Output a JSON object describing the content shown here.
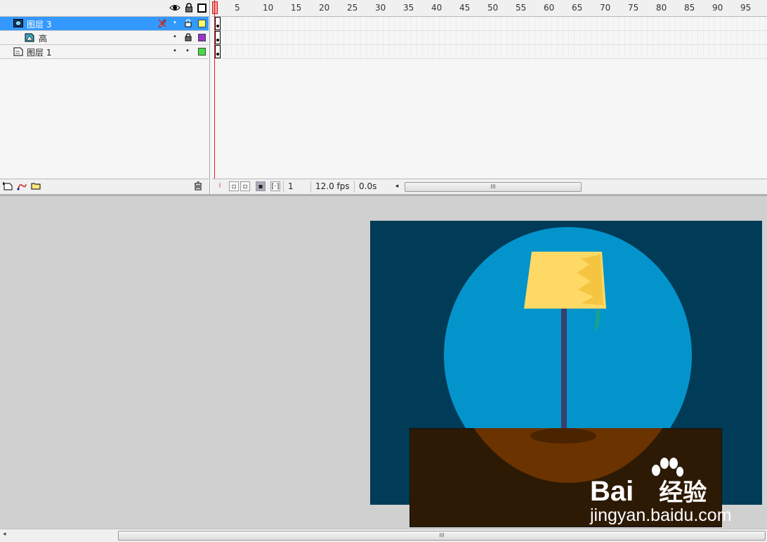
{
  "timeline": {
    "header_icons": [
      "eye-icon",
      "lock-icon",
      "outline-icon"
    ],
    "layers": [
      {
        "name": "图层 3",
        "type": "mask",
        "selected": true,
        "outline_color": "#ffff66"
      },
      {
        "name": "高",
        "type": "masked",
        "selected": false,
        "outline_color": "#9933cc"
      },
      {
        "name": "图层 1",
        "type": "normal",
        "selected": false,
        "outline_color": "#44dd44"
      }
    ],
    "ruler_ticks": [
      "1",
      "5",
      "10",
      "15",
      "20",
      "25",
      "30",
      "35",
      "40",
      "45",
      "50",
      "55",
      "60",
      "65",
      "70",
      "75",
      "80",
      "85",
      "90",
      "95"
    ],
    "current_frame": "1",
    "frame_rate": "12.0 fps",
    "elapsed_time": "0.0s",
    "scroll_grip": "III"
  },
  "watermark": {
    "brand": "Bai",
    "brand2": "经验",
    "sub": "jingyan.baidu.com"
  },
  "bottom_scroll": {
    "grip": "III"
  },
  "colors": {
    "stage_bg": "#003b57",
    "light": "#0494cc",
    "lampshade": "#ffd966",
    "pole": "#3a3f6b",
    "table": "#2d1a05",
    "selection": "#3399ff"
  }
}
